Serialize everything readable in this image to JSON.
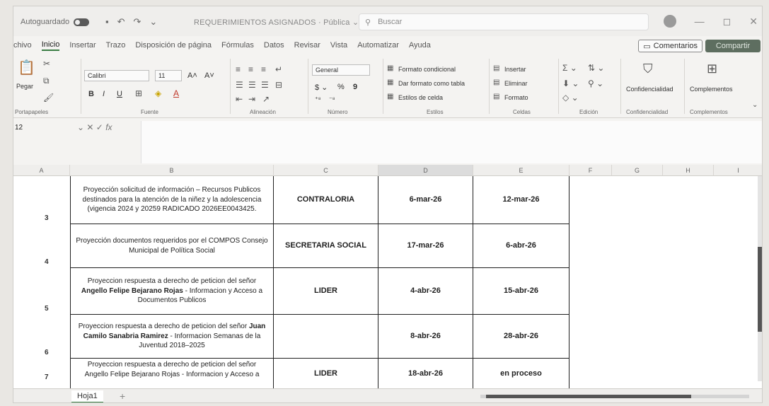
{
  "titlebar": {
    "autosave_label": "Autoguardado",
    "document_title": "REQUERIMIENTOS ASIGNADOS",
    "visibility": "Pública",
    "search_placeholder": "Buscar"
  },
  "menu": {
    "items": [
      "chivo",
      "Inicio",
      "Insertar",
      "Trazo",
      "Disposición de página",
      "Fórmulas",
      "Datos",
      "Revisar",
      "Vista",
      "Automatizar",
      "Ayuda"
    ],
    "active": "Inicio",
    "comments_label": "Comentarios",
    "share_label": "Compartir"
  },
  "ribbon": {
    "clipboard": {
      "paste_label": "Pegar",
      "group_label": "Portapapeles"
    },
    "font": {
      "font_name": "Calibri",
      "font_size": "11",
      "group_label": "Fuente",
      "bold": "B",
      "italic": "I",
      "underline": "U"
    },
    "alignment": {
      "group_label": "Alineación"
    },
    "number": {
      "format": "General",
      "group_label": "Número"
    },
    "styles": {
      "conditional": "Formato condicional",
      "as_table": "Dar formato como tabla",
      "cell_styles": "Estilos de celda",
      "group_label": "Estilos"
    },
    "cells": {
      "insert": "Insertar",
      "delete": "Eliminar",
      "format": "Formato",
      "group_label": "Celdas"
    },
    "editing": {
      "group_label": "Edición"
    },
    "sensitivity": {
      "label": "Confidencialidad",
      "group_label": "Confidencialidad"
    },
    "addins": {
      "label": "Complementos",
      "group_label": "Complementos"
    }
  },
  "formula_bar": {
    "name_box": "12",
    "fx": "fx"
  },
  "columns": [
    "A",
    "B",
    "C",
    "D",
    "E",
    "F",
    "G",
    "H",
    "I"
  ],
  "rows": [
    {
      "num": "3",
      "desc_pre": "Proyección solicitud de información – Recursos Publicos destinados para la atención de la niñez y la adolescencia (vigencia 2024 y 20259 RADICADO 2026EE0043425.",
      "desc_bold": "",
      "desc_post": "",
      "entity": "CONTRALORIA",
      "start": "6-mar-26",
      "end": "12-mar-26"
    },
    {
      "num": "4",
      "desc_pre": "Proyección documentos requeridos por el COMPOS Consejo Municipal de Política Social",
      "desc_bold": "",
      "desc_post": "",
      "entity": "SECRETARIA SOCIAL",
      "start": "17-mar-26",
      "end": "6-abr-26"
    },
    {
      "num": "5",
      "desc_pre": "Proyeccion respuesta a derecho de peticion del señor ",
      "desc_bold": "Angello Felipe Bejarano Rojas",
      "desc_post": " - Informacion y Acceso a Documentos Publicos",
      "entity": "LIDER",
      "start": "4-abr-26",
      "end": "15-abr-26"
    },
    {
      "num": "6",
      "desc_pre": "Proyeccion respuesta a derecho de peticion del señor ",
      "desc_bold": "Juan Camilo Sanabria Ramirez",
      "desc_post": " - Informacion Semanas de la Juventud 2018–2025",
      "entity": "",
      "start": "8-abr-26",
      "end": "28-abr-26"
    },
    {
      "num": "7",
      "desc_pre": "Proyeccion respuesta a derecho de peticion del señor Angello Felipe Bejarano Rojas - Informacion y Acceso a",
      "desc_bold": "",
      "desc_post": "",
      "entity": "LIDER",
      "start": "18-abr-26",
      "end": "en proceso"
    }
  ],
  "sheet": {
    "tab": "Hoja1",
    "add": "+"
  }
}
